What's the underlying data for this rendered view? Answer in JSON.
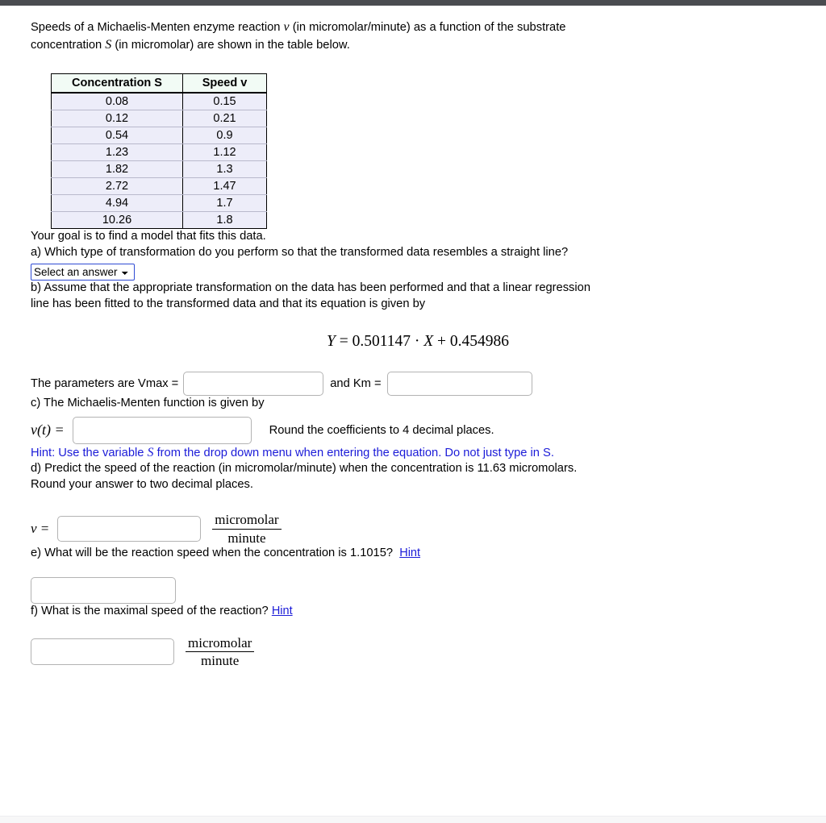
{
  "intro": {
    "line1_pre": "Speeds of a Michaelis-Menten enzyme reaction ",
    "var_v": "v",
    "line1_mid": " (in micromolar/minute) as a function of the substrate",
    "line2_pre": "concentration ",
    "var_S": "S",
    "line2_post": "  (in micromolar) are shown in the table below."
  },
  "table": {
    "headers": [
      "Concentration S",
      "Speed v"
    ],
    "rows": [
      [
        "0.08",
        "0.15"
      ],
      [
        "0.12",
        "0.21"
      ],
      [
        "0.54",
        "0.9"
      ],
      [
        "1.23",
        "1.12"
      ],
      [
        "1.82",
        "1.3"
      ],
      [
        "2.72",
        "1.47"
      ],
      [
        "4.94",
        "1.7"
      ],
      [
        "10.26",
        "1.8"
      ]
    ]
  },
  "goal": "Your goal is to find a model that fits this data.",
  "part_a": {
    "question": "a) Which type of transformation do you perform so that the transformed data resembles a straight line?",
    "select_value": "Select an answer",
    "options": [
      "Select an answer"
    ]
  },
  "part_b": {
    "line1": "b) Assume that the appropriate transformation on the data has been performed and that a linear regression",
    "line2": "line has been fitted to the transformed data and that its equation is given by",
    "equation": {
      "lhs": "Y",
      "eq": "=",
      "slope": "0.501147",
      "dot": "·",
      "x": "X",
      "plus": "+",
      "intercept": "0.454986",
      "full": "Y = 0.501147 · X + 0.454986"
    },
    "params_prefix": "The parameters are Vmax =",
    "params_middle": "and Km =",
    "vmax_value": "",
    "km_value": ""
  },
  "part_c": {
    "question": "c) The Michaelis-Menten function is given by",
    "func_label": "v(t) =",
    "input_value": "",
    "round_note": "Round the coefficients to 4 decimal places.",
    "hint_pre": "Hint: Use the variable ",
    "hint_var": "S",
    "hint_post": " from the drop down menu when entering the equation. Do not just type in S."
  },
  "part_d": {
    "line1": "d) Predict the speed of the reaction (in micromolar/minute) when the concentration is 11.63 micromolars.",
    "line2": "Round your answer to two decimal places.",
    "v_label": "v =",
    "input_value": "",
    "unit_numerator": "micromolar",
    "unit_denominator": "minute"
  },
  "part_e": {
    "question": "e) What will be the reaction speed when the concentration is 1.1015?",
    "hint_label": "Hint",
    "input_value": ""
  },
  "part_f": {
    "question": "f) What is the maximal speed of the reaction?",
    "hint_label": "Hint",
    "input_value": "",
    "unit_numerator": "micromolar",
    "unit_denominator": "minute"
  },
  "colors": {
    "hint_blue": "#1b1bd8",
    "select_border": "#2f4bd4",
    "table_header_bg": "#f2fbf5",
    "table_row_bg": "#ededf9",
    "chrome_top": "#4a4c50"
  }
}
